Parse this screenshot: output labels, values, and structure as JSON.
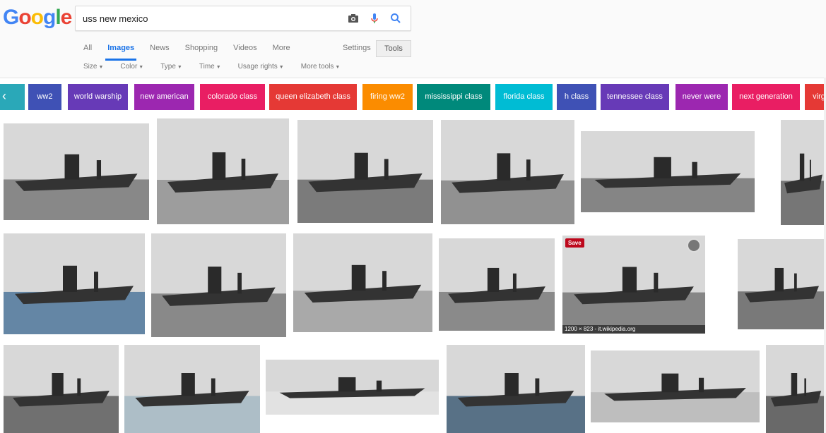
{
  "logo": {
    "letters": [
      "G",
      "o",
      "o",
      "g",
      "l",
      "e"
    ],
    "colors": [
      "#4285F4",
      "#EA4335",
      "#FBBC05",
      "#4285F4",
      "#34A853",
      "#EA4335"
    ]
  },
  "search": {
    "query": "uss new mexico",
    "icons": [
      "camera-icon",
      "mic-icon",
      "search-icon"
    ]
  },
  "nav": {
    "tabs": [
      {
        "label": "All"
      },
      {
        "label": "Images",
        "active": true
      },
      {
        "label": "News"
      },
      {
        "label": "Shopping"
      },
      {
        "label": "Videos"
      },
      {
        "label": "More"
      }
    ],
    "settings": "Settings",
    "tools": "Tools"
  },
  "filters": [
    {
      "label": "Size"
    },
    {
      "label": "Color"
    },
    {
      "label": "Type"
    },
    {
      "label": "Time"
    },
    {
      "label": "Usage rights"
    },
    {
      "label": "More tools"
    }
  ],
  "chips": [
    {
      "label": "ww2",
      "color": "#3f51b5"
    },
    {
      "label": "world warship",
      "color": "#673ab7"
    },
    {
      "label": "new american",
      "color": "#9c27b0"
    },
    {
      "label": "colorado class",
      "color": "#e91e63"
    },
    {
      "label": "queen elizabeth class",
      "color": "#e53935"
    },
    {
      "label": "firing ww2",
      "color": "#fb8c00"
    },
    {
      "label": "mississippi class",
      "color": "#00897b"
    },
    {
      "label": "florida class",
      "color": "#00bcd4"
    },
    {
      "label": "h class",
      "color": "#3f51b5"
    },
    {
      "label": "tennessee class",
      "color": "#673ab7"
    },
    {
      "label": "never were",
      "color": "#9c27b0"
    },
    {
      "label": "next generation",
      "color": "#e91e63"
    },
    {
      "label": "virg",
      "color": "#e53935"
    }
  ],
  "results": [
    {
      "alt": "battleship at sea",
      "tone": "#6e6e6e"
    },
    {
      "alt": "battleships at anchor",
      "tone": "#8a8a8a"
    },
    {
      "alt": "battleship in dazzle camouflage",
      "tone": "#5c5c5c"
    },
    {
      "alt": "battleship aerial view",
      "tone": "#7a7a7a"
    },
    {
      "alt": "battleship underway aerial",
      "tone": "#6a6a6a"
    },
    {
      "alt": "battleship bow wave",
      "tone": "#555555"
    },
    {
      "alt": "submarine at pier",
      "tone": "#3d6b94"
    },
    {
      "alt": "battleship bow view",
      "tone": "#6f6f6f"
    },
    {
      "alt": "battleship with smoke",
      "tone": "#9a9a9a"
    },
    {
      "alt": "battleship with mountain",
      "tone": "#707070"
    },
    {
      "alt": "battleship in harbor",
      "tone": "#6b6b6b",
      "save": "Save",
      "meta": "1200 × 823 - it.wikipedia.org"
    },
    {
      "alt": "battleship close view",
      "tone": "#5a5a5a"
    },
    {
      "alt": "battleship overhead",
      "tone": "#4e4e4e"
    },
    {
      "alt": "painted battleship",
      "tone": "#9fb6c2"
    },
    {
      "alt": "battleship drawing",
      "tone": "#e6e6e6"
    },
    {
      "alt": "battleship game render",
      "tone": "#2d4f6b"
    },
    {
      "alt": "battleship profile",
      "tone": "#b5b5b5"
    },
    {
      "alt": "battleship tugboat",
      "tone": "#444444"
    }
  ]
}
